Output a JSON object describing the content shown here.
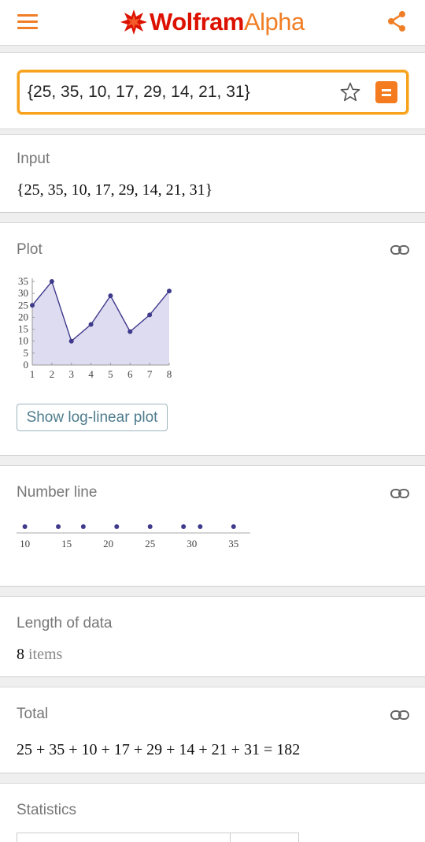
{
  "header": {
    "logo_wolfram": "Wolfram",
    "logo_alpha": "Alpha",
    "brand_red": "#dd1100",
    "accent_orange": "#f07e26"
  },
  "search": {
    "query": "{25, 35, 10, 17, 29, 14, 21, 31}"
  },
  "pods": {
    "input": {
      "title": "Input",
      "value": "{25, 35, 10, 17, 29, 14, 21, 31}"
    },
    "plot": {
      "title": "Plot",
      "button_label": "Show log-linear plot"
    },
    "number_line": {
      "title": "Number line"
    },
    "length": {
      "title": "Length of data",
      "count": "8",
      "unit": "items"
    },
    "total": {
      "title": "Total",
      "value": "25 + 35 + 10 + 17 + 29 + 14 + 21 + 31 = 182"
    },
    "statistics": {
      "title": "Statistics"
    }
  },
  "chart_data": [
    {
      "type": "area",
      "x": [
        1,
        2,
        3,
        4,
        5,
        6,
        7,
        8
      ],
      "values": [
        25,
        35,
        10,
        17,
        29,
        14,
        21,
        31
      ],
      "xticks": [
        "1",
        "2",
        "3",
        "4",
        "5",
        "6",
        "7",
        "8"
      ],
      "yticks": [
        "0",
        "5",
        "10",
        "15",
        "20",
        "25",
        "30",
        "35"
      ],
      "xlim": [
        1,
        8
      ],
      "ylim": [
        0,
        35
      ],
      "line_color": "#3f3a8c",
      "fill_color": "#dedcf0"
    },
    {
      "type": "scatter",
      "values": [
        10,
        14,
        17,
        21,
        25,
        29,
        31,
        35
      ],
      "xticks": [
        "10",
        "15",
        "20",
        "25",
        "30",
        "35"
      ],
      "xlim": [
        9,
        37
      ],
      "point_color": "#3f3a8c"
    }
  ]
}
